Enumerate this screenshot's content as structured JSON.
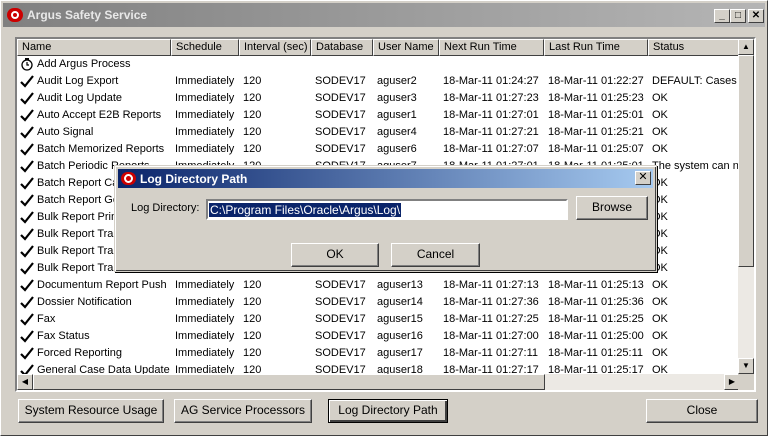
{
  "window": {
    "title": "Argus Safety Service",
    "min": "_",
    "max": "□",
    "close": "✕"
  },
  "columns": [
    "Name",
    "Schedule",
    "Interval (sec)",
    "Database",
    "User Name",
    "Next Run Time",
    "Last Run Time",
    "Status"
  ],
  "rows": [
    {
      "check": false,
      "icon": "clock-icon",
      "name": "Add Argus Process",
      "schedule": "",
      "interval": "",
      "database": "",
      "user": "",
      "next": "",
      "last": "",
      "status": ""
    },
    {
      "check": true,
      "name": "Audit Log Export",
      "schedule": "Immediately",
      "interval": "120",
      "database": "SODEV17",
      "user": "aguser2",
      "next": "18-Mar-11 01:24:27",
      "last": "18-Mar-11 01:22:27",
      "status": "DEFAULT: Cases l"
    },
    {
      "check": true,
      "name": "Audit Log Update",
      "schedule": "Immediately",
      "interval": "120",
      "database": "SODEV17",
      "user": "aguser3",
      "next": "18-Mar-11 01:27:23",
      "last": "18-Mar-11 01:25:23",
      "status": "OK"
    },
    {
      "check": true,
      "name": "Auto Accept E2B Reports",
      "schedule": "Immediately",
      "interval": "120",
      "database": "SODEV17",
      "user": "aguser1",
      "next": "18-Mar-11 01:27:01",
      "last": "18-Mar-11 01:25:01",
      "status": "OK"
    },
    {
      "check": true,
      "name": "Auto Signal",
      "schedule": "Immediately",
      "interval": "120",
      "database": "SODEV17",
      "user": "aguser4",
      "next": "18-Mar-11 01:27:21",
      "last": "18-Mar-11 01:25:21",
      "status": "OK"
    },
    {
      "check": true,
      "name": "Batch Memorized Reports",
      "schedule": "Immediately",
      "interval": "120",
      "database": "SODEV17",
      "user": "aguser6",
      "next": "18-Mar-11 01:27:07",
      "last": "18-Mar-11 01:25:07",
      "status": "OK"
    },
    {
      "check": true,
      "name": "Batch Periodic Reports",
      "schedule": "Immediately",
      "interval": "120",
      "database": "SODEV17",
      "user": "aguser7",
      "next": "18-Mar-11 01:27:01",
      "last": "18-Mar-11 01:25:01",
      "status": "The system can no"
    },
    {
      "check": true,
      "name": "Batch Report Ca",
      "schedule": "",
      "interval": "",
      "database": "",
      "user": "",
      "next": "",
      "last": "",
      "status": "OK"
    },
    {
      "check": true,
      "name": "Batch Report Ge",
      "schedule": "",
      "interval": "",
      "database": "",
      "user": "",
      "next": "",
      "last": "",
      "status": "OK"
    },
    {
      "check": true,
      "name": "Bulk Report Print",
      "schedule": "",
      "interval": "",
      "database": "",
      "user": "",
      "next": "",
      "last": "",
      "status": "OK"
    },
    {
      "check": true,
      "name": "Bulk Report Tran",
      "schedule": "",
      "interval": "",
      "database": "",
      "user": "",
      "next": "",
      "last": "",
      "status": "OK"
    },
    {
      "check": true,
      "name": "Bulk Report Tran",
      "schedule": "",
      "interval": "",
      "database": "",
      "user": "",
      "next": "",
      "last": "",
      "status": "OK"
    },
    {
      "check": true,
      "name": "Bulk Report Tran",
      "schedule": "",
      "interval": "",
      "database": "",
      "user": "",
      "next": "",
      "last": "",
      "status": "OK"
    },
    {
      "check": true,
      "name": "Documentum Report Push",
      "schedule": "Immediately",
      "interval": "120",
      "database": "SODEV17",
      "user": "aguser13",
      "next": "18-Mar-11 01:27:13",
      "last": "18-Mar-11 01:25:13",
      "status": "OK"
    },
    {
      "check": true,
      "name": "Dossier Notification",
      "schedule": "Immediately",
      "interval": "120",
      "database": "SODEV17",
      "user": "aguser14",
      "next": "18-Mar-11 01:27:36",
      "last": "18-Mar-11 01:25:36",
      "status": "OK"
    },
    {
      "check": true,
      "name": "Fax",
      "schedule": "Immediately",
      "interval": "120",
      "database": "SODEV17",
      "user": "aguser15",
      "next": "18-Mar-11 01:27:25",
      "last": "18-Mar-11 01:25:25",
      "status": "OK"
    },
    {
      "check": true,
      "name": "Fax Status",
      "schedule": "Immediately",
      "interval": "120",
      "database": "SODEV17",
      "user": "aguser16",
      "next": "18-Mar-11 01:27:00",
      "last": "18-Mar-11 01:25:00",
      "status": "OK"
    },
    {
      "check": true,
      "name": "Forced Reporting",
      "schedule": "Immediately",
      "interval": "120",
      "database": "SODEV17",
      "user": "aguser17",
      "next": "18-Mar-11 01:27:11",
      "last": "18-Mar-11 01:25:11",
      "status": "OK"
    },
    {
      "check": true,
      "name": "General Case Data Update",
      "schedule": "Immediately",
      "interval": "120",
      "database": "SODEV17",
      "user": "aguser18",
      "next": "18-Mar-11 01:27:17",
      "last": "18-Mar-11 01:25:17",
      "status": "OK"
    }
  ],
  "buttons": {
    "system_resource": "System Resource Usage",
    "ag_service": "AG Service Processors",
    "log_dir": "Log Directory Path",
    "close": "Close"
  },
  "dialog": {
    "title": "Log Directory Path",
    "label": "Log Directory:",
    "value": "C:\\Program Files\\Oracle\\Argus\\Log\\",
    "browse": "Browse",
    "ok": "OK",
    "cancel": "Cancel",
    "close": "✕"
  }
}
